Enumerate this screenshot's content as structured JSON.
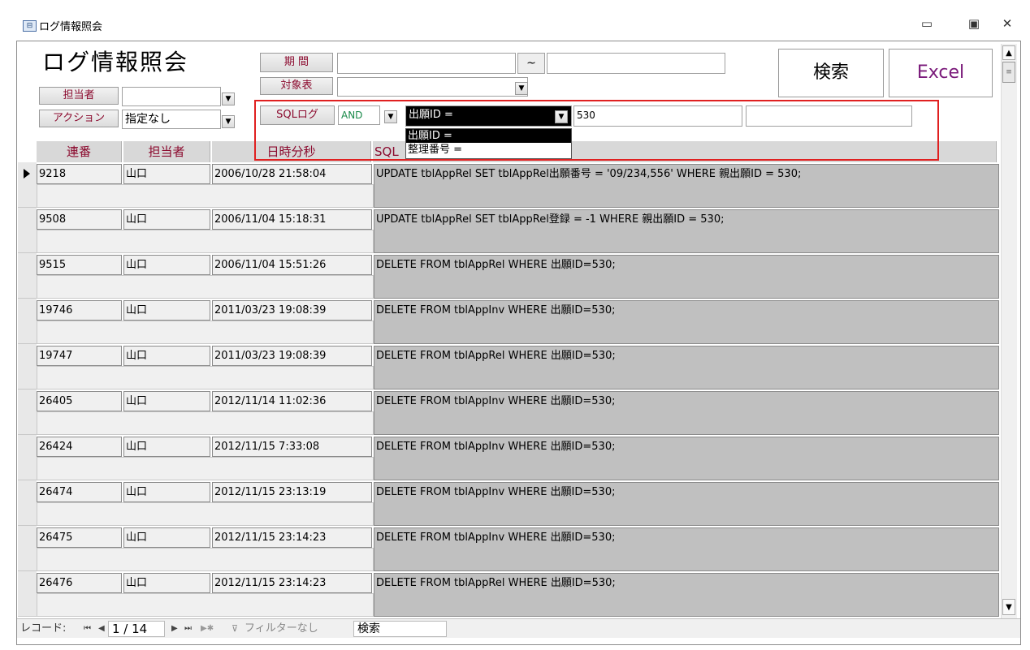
{
  "window": {
    "title": "ログ情報照会",
    "icon": "form-icon",
    "controls": [
      "minimize-icon",
      "restore-icon",
      "close-icon"
    ]
  },
  "form": {
    "title": "ログ情報照会",
    "tanto_label": "担当者",
    "tanto_value": "",
    "action_label": "アクション",
    "action_value": "指定なし",
    "period_label": "期 間",
    "period_from": "",
    "period_sep": "~",
    "period_to": "",
    "target_label": "対象表",
    "target_value": "",
    "sqllog_label": "SQLログ",
    "sqllog_op": "AND",
    "sqllog_field": "出願ID =",
    "sqllog_value1": "530",
    "sqllog_value2": "",
    "search_button": "検索",
    "excel_button": "Excel"
  },
  "dropdown": {
    "options": [
      "出願ID =",
      "整理番号 ="
    ],
    "selected": 0
  },
  "columns": [
    "連番",
    "担当者",
    "日時分秒",
    "SQL"
  ],
  "rows": [
    {
      "id": "9218",
      "user": "山口",
      "datetime": "2006/10/28 21:58:04",
      "sql": "UPDATE tblAppRel SET  tblAppRel出願番号 = '09/234,556' WHERE 親出願ID = 530;"
    },
    {
      "id": "9508",
      "user": "山口",
      "datetime": "2006/11/04 15:18:31",
      "sql": "UPDATE tblAppRel SET  tblAppRel登録 = -1  WHERE 親出願ID = 530;"
    },
    {
      "id": "9515",
      "user": "山口",
      "datetime": "2006/11/04 15:51:26",
      "sql": "DELETE FROM tblAppRel WHERE 出願ID=530;"
    },
    {
      "id": "19746",
      "user": "山口",
      "datetime": "2011/03/23 19:08:39",
      "sql": "DELETE FROM tblAppInv WHERE 出願ID=530;"
    },
    {
      "id": "19747",
      "user": "山口",
      "datetime": "2011/03/23 19:08:39",
      "sql": "DELETE FROM tblAppRel WHERE 出願ID=530;"
    },
    {
      "id": "26405",
      "user": "山口",
      "datetime": "2012/11/14 11:02:36",
      "sql": "DELETE FROM tblAppInv WHERE 出願ID=530;"
    },
    {
      "id": "26424",
      "user": "山口",
      "datetime": "2012/11/15 7:33:08",
      "sql": "DELETE FROM tblAppInv WHERE 出願ID=530;"
    },
    {
      "id": "26474",
      "user": "山口",
      "datetime": "2012/11/15 23:13:19",
      "sql": "DELETE FROM tblAppInv WHERE 出願ID=530;"
    },
    {
      "id": "26475",
      "user": "山口",
      "datetime": "2012/11/15 23:14:23",
      "sql": "DELETE FROM tblAppInv WHERE 出願ID=530;"
    },
    {
      "id": "26476",
      "user": "山口",
      "datetime": "2012/11/15 23:14:23",
      "sql": "DELETE FROM tblAppRel WHERE 出願ID=530;"
    }
  ],
  "navbar": {
    "record_label": "レコード:",
    "record_position": "1 / 14",
    "filter_label": "フィルターなし",
    "search_placeholder": "検索"
  }
}
